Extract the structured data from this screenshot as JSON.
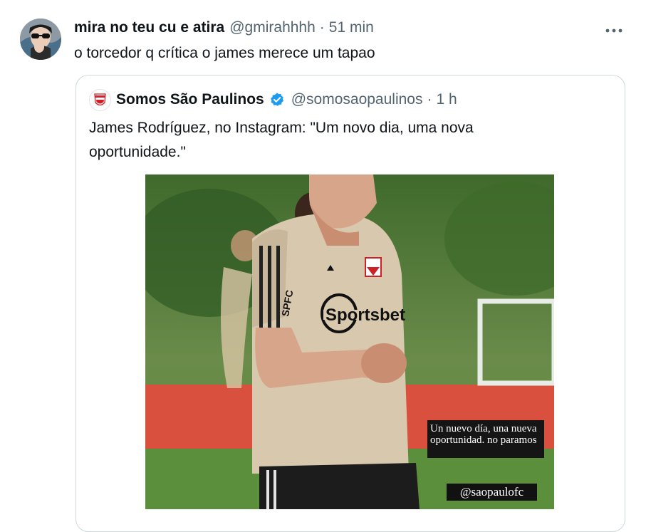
{
  "tweet": {
    "author_name": "mira no teu cu e atira",
    "author_handle": "@gmirahhhh",
    "separator": "·",
    "time": "51 min",
    "more_label": "•••",
    "text": "o torcedor q crítica o james merece um tapao"
  },
  "quote": {
    "author_name": "Somos São Paulinos",
    "author_handle": "@somosaopaulinos",
    "separator": "·",
    "time": "1 h",
    "text": "James Rodríguez, no Instagram: \"Um novo dia, uma nova oportunidade.\"",
    "media": {
      "story_caption": "Un nuevo día, una nueva oportunidad. no paramos",
      "story_mention": "@saopaulofc",
      "shirt_brand": "Sportsbet",
      "badge_text": "SPFC"
    }
  },
  "icons": {
    "more": "more-dots-icon",
    "verified": "verified-badge-icon"
  },
  "colors": {
    "text_primary": "#0f1419",
    "text_secondary": "#536471",
    "border": "#cfd9de",
    "verified": "#1d9bf0"
  }
}
